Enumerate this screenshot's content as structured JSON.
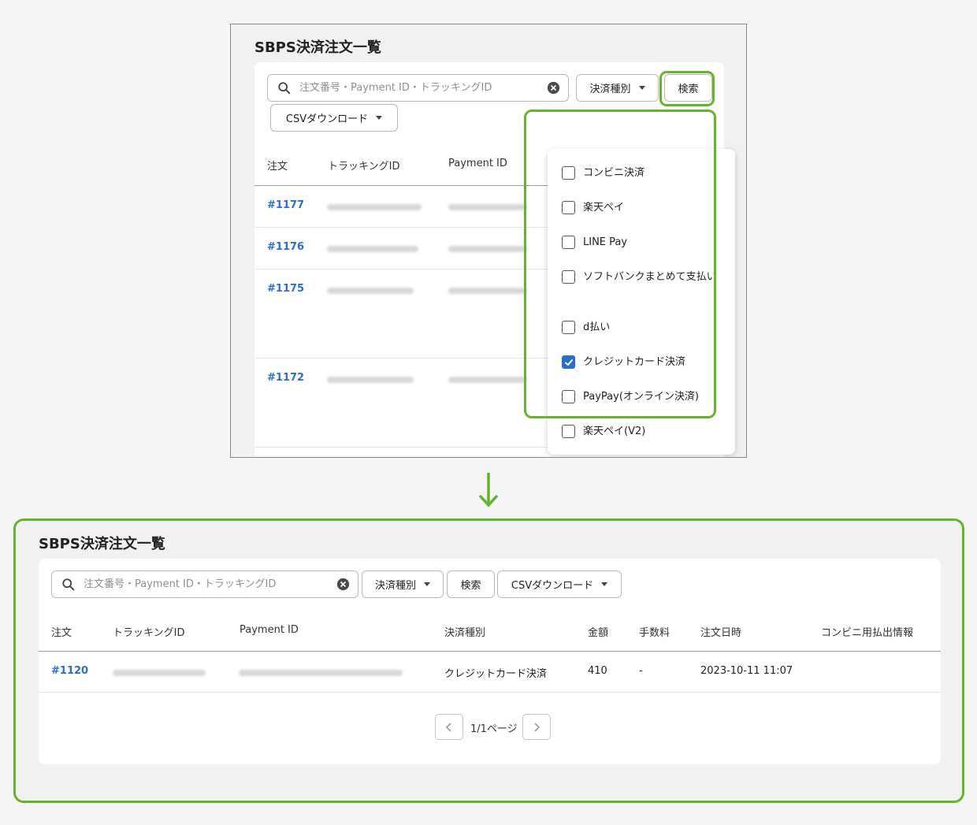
{
  "top": {
    "title": "SBPS決済注文一覧",
    "search_placeholder": "注文番号・Payment ID・トラッキングID",
    "payment_type_label": "決済種別",
    "search_label": "検索",
    "csv_label": "CSVダウンロード",
    "columns": [
      "注文",
      "トラッキングID",
      "Payment ID"
    ],
    "rows": [
      "#1177",
      "#1176",
      "#1175",
      "#1172"
    ],
    "dropdown_options": [
      {
        "label": "コンビニ決済",
        "checked": false
      },
      {
        "label": "楽天ペイ",
        "checked": false
      },
      {
        "label": "LINE Pay",
        "checked": false
      },
      {
        "label": "ソフトバンクまとめて支払い",
        "checked": false
      },
      {
        "label": "d払い",
        "checked": false
      },
      {
        "label": "クレジットカード決済",
        "checked": true
      },
      {
        "label": "PayPay(オンライン決済)",
        "checked": false
      },
      {
        "label": "楽天ペイ(V2)",
        "checked": false
      }
    ]
  },
  "bottom": {
    "title": "SBPS決済注文一覧",
    "search_placeholder": "注文番号・Payment ID・トラッキングID",
    "payment_type_label": "決済種別",
    "search_label": "検索",
    "csv_label": "CSVダウンロード",
    "columns": [
      "注文",
      "トラッキングID",
      "Payment ID",
      "決済種別",
      "金額",
      "手数料",
      "注文日時",
      "コンビニ用払出情報"
    ],
    "row": {
      "order": "#1120",
      "payment_type": "クレジットカード決済",
      "amount": "410",
      "fee": "-",
      "datetime": "2023-10-11 11:07"
    },
    "pager": "1/1ページ"
  },
  "colors": {
    "highlight": "#67b32d",
    "link": "#2c6ecb"
  }
}
